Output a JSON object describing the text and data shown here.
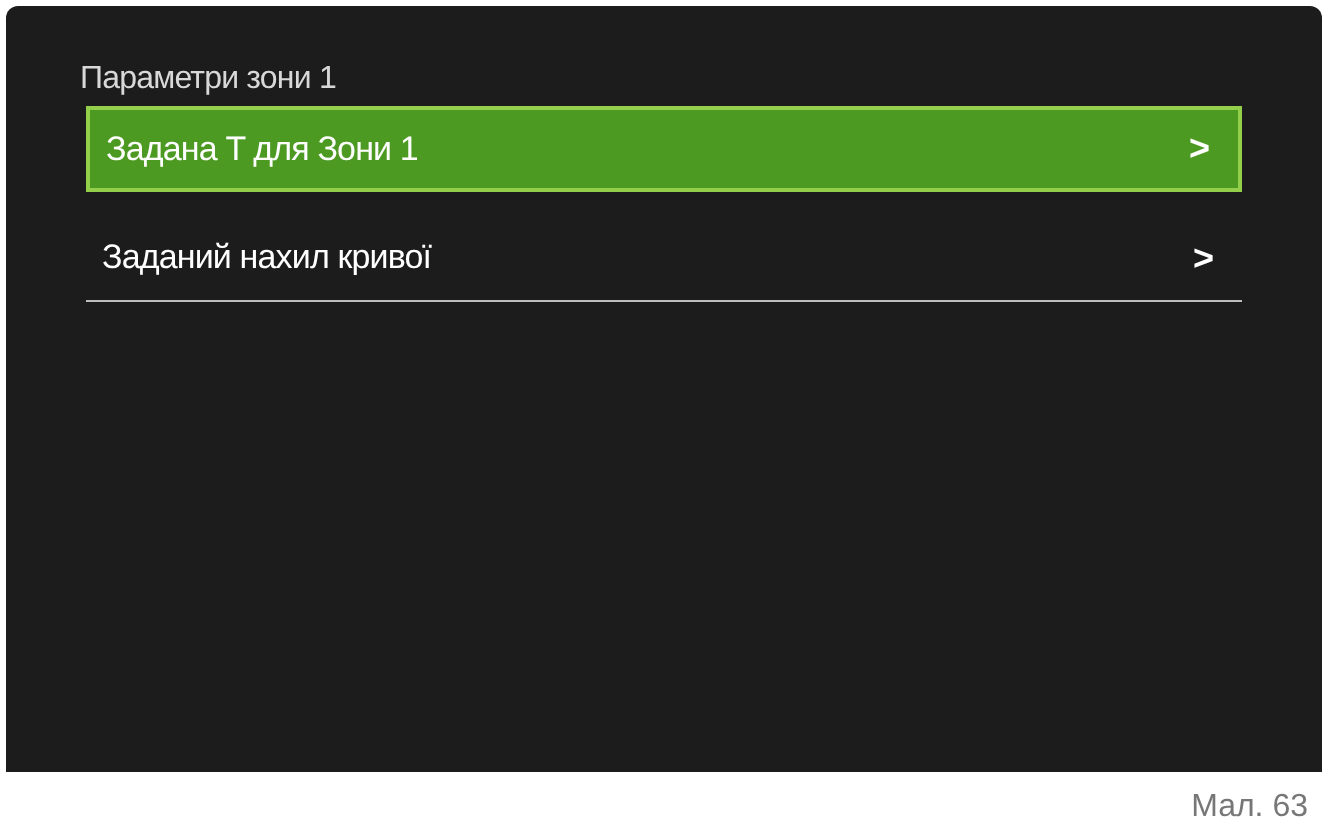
{
  "screen": {
    "title": "Параметри зони 1",
    "items": [
      {
        "label": "Задана T для Зони 1",
        "arrow": ">",
        "selected": true
      },
      {
        "label": "Заданий нахил кривої",
        "arrow": ">",
        "selected": false
      }
    ]
  },
  "caption": "Мал. 63"
}
